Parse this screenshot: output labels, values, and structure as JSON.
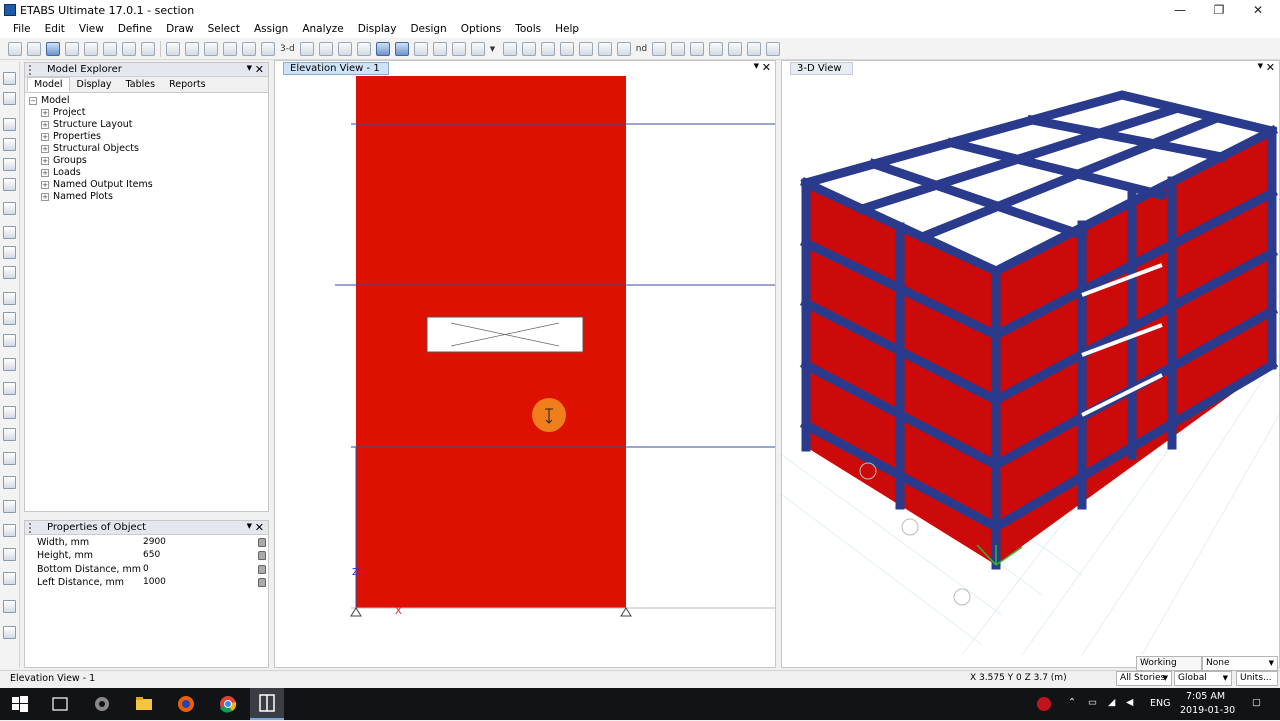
{
  "window": {
    "title": "ETABS Ultimate 17.0.1 - section",
    "controls": {
      "minimize": "—",
      "maximize": "❐",
      "close": "✕"
    }
  },
  "menu": [
    "File",
    "Edit",
    "View",
    "Define",
    "Draw",
    "Select",
    "Assign",
    "Analyze",
    "Display",
    "Design",
    "Options",
    "Tools",
    "Help"
  ],
  "toolbar": {
    "text_3d": "3-d",
    "text_plan": "nd"
  },
  "model_explorer": {
    "title": "Model Explorer",
    "tabs": [
      "Model",
      "Display",
      "Tables",
      "Reports"
    ],
    "active_tab": "Model",
    "root": "Model",
    "items": [
      "Project",
      "Structure Layout",
      "Properties",
      "Structural Objects",
      "Groups",
      "Loads",
      "Named Output Items",
      "Named Plots"
    ]
  },
  "properties": {
    "title": "Properties of Object",
    "rows": [
      {
        "name": "Width, mm",
        "value": "2900"
      },
      {
        "name": "Height, mm",
        "value": "650"
      },
      {
        "name": "Bottom Distance, mm",
        "value": "0"
      },
      {
        "name": "Left Distance, mm",
        "value": "1000"
      }
    ]
  },
  "elevation_view": {
    "title": "Elevation View - 1",
    "axis_z": "Z",
    "axis_x": "X",
    "wall_color": "#dd1100"
  },
  "view_3d": {
    "title": "3-D View",
    "frame_color": "#2a3a8c",
    "wall_color": "#cc0a0a"
  },
  "status": {
    "left": "Elevation View - 1",
    "coords": "X 3.575  Y 0  Z 3.7 (m)",
    "working_plane_label": "Working Plane",
    "working_plane_value": "None",
    "stories": "All Stories",
    "coord_system": "Global",
    "units": "Units..."
  },
  "taskbar": {
    "time": "7:05 AM",
    "date": "2019-01-30",
    "lang": "ENG"
  }
}
